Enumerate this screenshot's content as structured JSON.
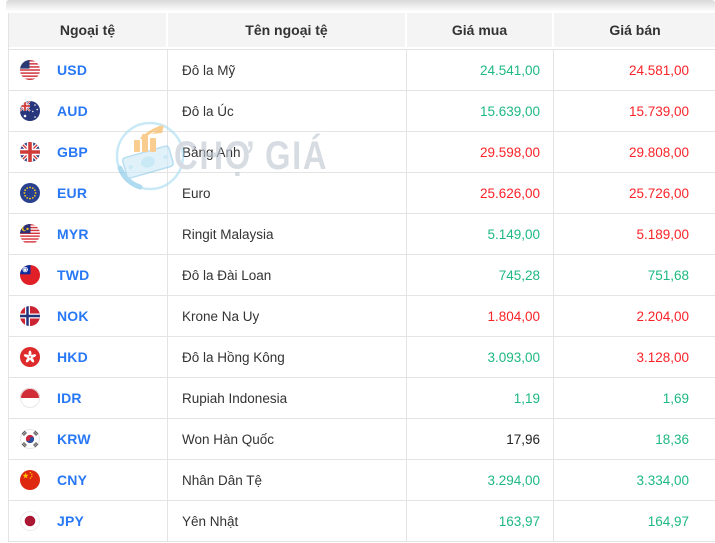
{
  "header": {
    "columns": [
      "Ngoại tệ",
      "Tên ngoại tệ",
      "Giá mua",
      "Giá bán"
    ]
  },
  "watermark": {
    "text": "CHỢ GIÁ"
  },
  "colors": {
    "up": "#1eb982",
    "down": "#fa2329",
    "flat": "#222222",
    "code_link": "#2878f5"
  },
  "rows": [
    {
      "flag": "usd",
      "code": "USD",
      "name": "Đô la Mỹ",
      "buy": "24.541,00",
      "sell": "24.581,00",
      "buy_trend": "up",
      "sell_trend": "down"
    },
    {
      "flag": "aud",
      "code": "AUD",
      "name": "Đô la Úc",
      "buy": "15.639,00",
      "sell": "15.739,00",
      "buy_trend": "up",
      "sell_trend": "down"
    },
    {
      "flag": "gbp",
      "code": "GBP",
      "name": "Bảng Anh",
      "buy": "29.598,00",
      "sell": "29.808,00",
      "buy_trend": "down",
      "sell_trend": "down"
    },
    {
      "flag": "eur",
      "code": "EUR",
      "name": "Euro",
      "buy": "25.626,00",
      "sell": "25.726,00",
      "buy_trend": "down",
      "sell_trend": "down"
    },
    {
      "flag": "myr",
      "code": "MYR",
      "name": "Ringit Malaysia",
      "buy": "5.149,00",
      "sell": "5.189,00",
      "buy_trend": "up",
      "sell_trend": "down"
    },
    {
      "flag": "twd",
      "code": "TWD",
      "name": "Đô la Đài Loan",
      "buy": "745,28",
      "sell": "751,68",
      "buy_trend": "up",
      "sell_trend": "up"
    },
    {
      "flag": "nok",
      "code": "NOK",
      "name": "Krone Na Uy",
      "buy": "1.804,00",
      "sell": "2.204,00",
      "buy_trend": "down",
      "sell_trend": "down"
    },
    {
      "flag": "hkd",
      "code": "HKD",
      "name": "Đô la Hồng Kông",
      "buy": "3.093,00",
      "sell": "3.128,00",
      "buy_trend": "up",
      "sell_trend": "down"
    },
    {
      "flag": "idr",
      "code": "IDR",
      "name": "Rupiah Indonesia",
      "buy": "1,19",
      "sell": "1,69",
      "buy_trend": "up",
      "sell_trend": "up"
    },
    {
      "flag": "krw",
      "code": "KRW",
      "name": "Won Hàn Quốc",
      "buy": "17,96",
      "sell": "18,36",
      "buy_trend": "flat",
      "sell_trend": "up"
    },
    {
      "flag": "cny",
      "code": "CNY",
      "name": "Nhân Dân Tệ",
      "buy": "3.294,00",
      "sell": "3.334,00",
      "buy_trend": "up",
      "sell_trend": "up"
    },
    {
      "flag": "jpy",
      "code": "JPY",
      "name": "Yên Nhật",
      "buy": "163,97",
      "sell": "164,97",
      "buy_trend": "up",
      "sell_trend": "up"
    }
  ]
}
